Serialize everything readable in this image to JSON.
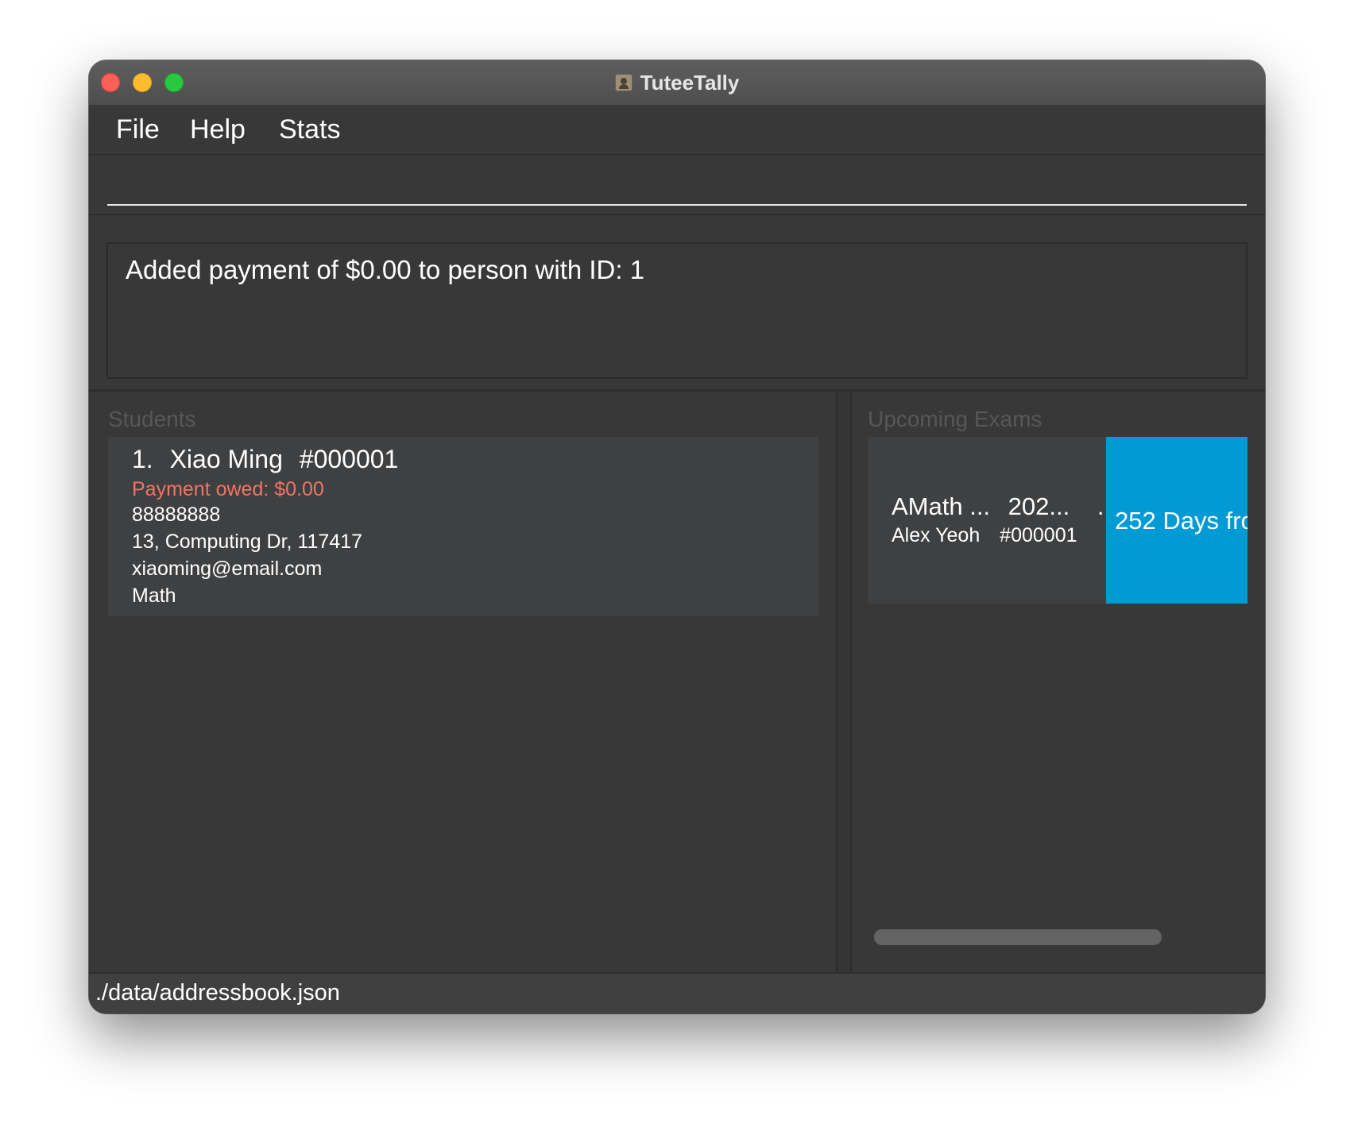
{
  "window": {
    "title": "TuteeTally"
  },
  "menu": {
    "items": [
      "File",
      "Help",
      "Stats"
    ]
  },
  "command_box": {
    "value": "",
    "placeholder": ""
  },
  "result_display": {
    "message": "Added payment of $0.00 to person with ID: 1"
  },
  "students_panel": {
    "label": "Students",
    "items": [
      {
        "index": "1.",
        "name": "Xiao Ming",
        "id": "#000001",
        "payment_owed": "Payment owed: $0.00",
        "phone": "88888888",
        "address": "13, Computing Dr, 117417",
        "email": "xiaoming@email.com",
        "subject": "Math"
      }
    ]
  },
  "exams_panel": {
    "label": "Upcoming Exams",
    "items": [
      {
        "exam_name": "AMath ...",
        "date": "202...",
        "extra": "...",
        "student_name": "Alex Yeoh",
        "student_id": "#000001",
        "days_label": "252 Days fro"
      }
    ]
  },
  "status_bar": {
    "path": "./data/addressbook.json"
  },
  "colors": {
    "background": "#383838",
    "card": "#3f4042",
    "payment_owed": "#f17462",
    "days_badge": "#009ad4",
    "panel_label": "#575757"
  }
}
